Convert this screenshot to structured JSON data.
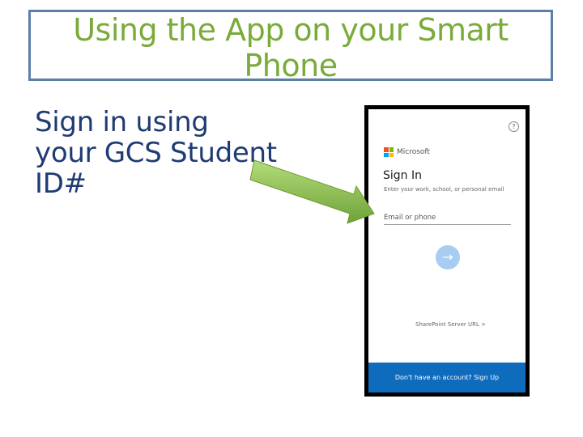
{
  "slide": {
    "title_line1": "Using the App on your Smart",
    "title_line2": "Phone",
    "body_line1": "Sign in using",
    "body_line2": "your GCS Student",
    "body_line3": "ID#"
  },
  "phone": {
    "help_icon": "?",
    "brand": "Microsoft",
    "heading": "Sign In",
    "subtitle": "Enter your work, school, or personal email",
    "email_placeholder": "Email or phone",
    "next_icon": "→",
    "sharepoint_link": "SharePoint Server URL  >",
    "signup_text": "Don't have an account? Sign Up"
  },
  "colors": {
    "title": "#7aab3a",
    "body_text": "#1f3b73",
    "title_border": "#5b7fa6",
    "arrow": "#8dc14b",
    "signup_bar": "#0f6cbd"
  }
}
